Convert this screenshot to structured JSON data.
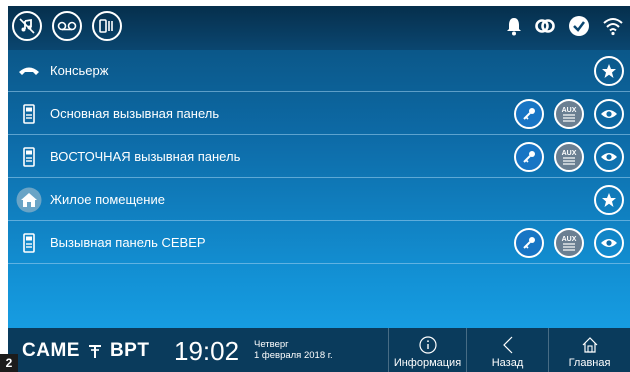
{
  "status": {
    "left_icons": [
      "music-off-icon",
      "voicemail-icon",
      "intercom-icon"
    ],
    "right_icons": [
      "bell-icon",
      "link-icon",
      "check-circle-icon",
      "wifi-icon"
    ]
  },
  "rows": [
    {
      "label": "Консьерж",
      "icon": "handset-icon",
      "actions": [
        "star"
      ]
    },
    {
      "label": "Основная вызывная панель",
      "icon": "door-panel-icon",
      "actions": [
        "key",
        "aux",
        "eye"
      ]
    },
    {
      "label": "ВОСТОЧНАЯ вызывная панель",
      "icon": "door-panel-icon",
      "actions": [
        "key",
        "aux",
        "eye"
      ]
    },
    {
      "label": "Жилое помещение",
      "icon": "home-icon",
      "actions": [
        "star"
      ]
    },
    {
      "label": "Вызывная панель СЕВЕР",
      "icon": "door-panel-icon",
      "actions": [
        "key",
        "aux",
        "eye"
      ]
    }
  ],
  "aux_label": "AUX",
  "footer": {
    "logo": "CAME",
    "logo2": "BPT",
    "time": "19:02",
    "weekday": "Четверг",
    "date": "1 февраля 2018 г.",
    "info_label": "Информация",
    "back_label": "Назад",
    "home_label": "Главная"
  },
  "page_number": "2"
}
